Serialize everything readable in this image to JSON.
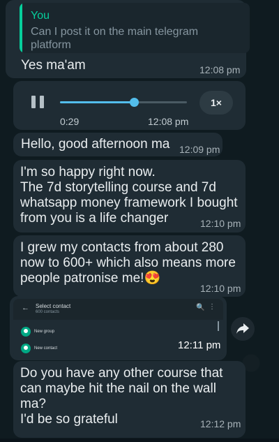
{
  "reply": {
    "quote_author": "You",
    "quote_text": "Can I post it on the main telegram platform",
    "text": "Yes ma'am",
    "time": "12:08 pm"
  },
  "audio": {
    "elapsed": "0:29",
    "time": "12:08 pm",
    "speed": "1×",
    "progress": 0.58
  },
  "messages": [
    {
      "text": "Hello, good afternoon ma",
      "time": "12:09 pm"
    },
    {
      "text": "I'm so happy right now.\nThe 7d storytelling course and 7d\nwhatsapp money framework I bought\nfrom you is a life changer",
      "time": "12:10 pm"
    },
    {
      "text": "I grew my contacts from about 280\nnow to 600+ which also means more\npeople patronise me!",
      "emoji": "😍",
      "time": "12:10 pm"
    },
    {
      "text": "Do you have any other course that\ncan maybe hit the nail on the wall\nma?\nI'd be so grateful",
      "time": "12:12 pm"
    }
  ],
  "image_message": {
    "time": "12:11 pm",
    "screenshot": {
      "back": "←",
      "title": "Select contact",
      "subtitle": "600 contacts",
      "search": "🔍",
      "menu": "⋮",
      "rows": [
        {
          "label": "New group",
          "icon": "group-icon"
        },
        {
          "label": "New contact",
          "icon": "add-contact-icon"
        }
      ]
    }
  },
  "colors": {
    "background": "#0f1b20",
    "bubble": "#1f2c34",
    "accent": "#06cf9c",
    "audio_progress": "#53bdeb"
  }
}
